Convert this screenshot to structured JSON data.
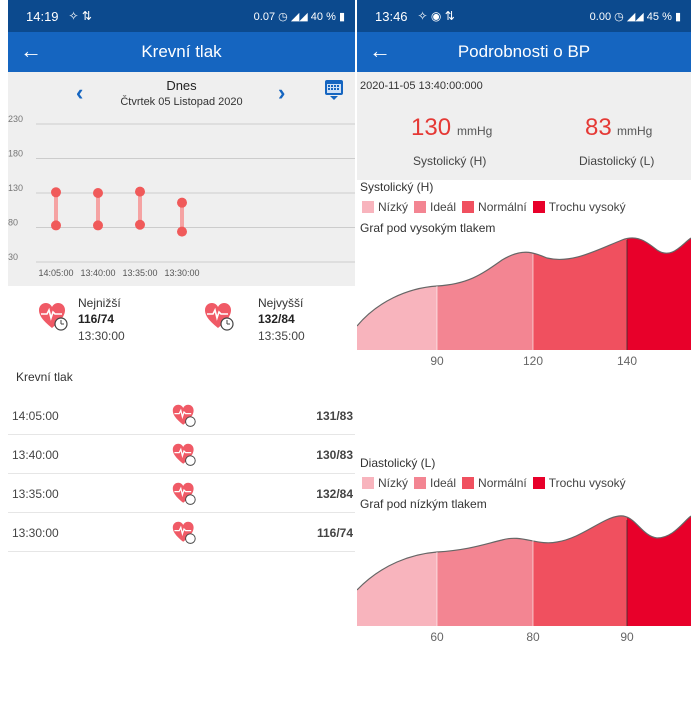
{
  "left": {
    "status": {
      "time": "14:19",
      "data_rate": "0.07",
      "battery": "40 %"
    },
    "appbar": {
      "title": "Krevní tlak"
    },
    "datebar": {
      "day_label": "Dnes",
      "date_text": "Čtvrtek 05 Listopad 2020"
    },
    "chart": {
      "type": "range",
      "y_ticks": [
        "230",
        "180",
        "130",
        "80",
        "30"
      ],
      "x_labels": [
        "14:05:00",
        "13:40:00",
        "13:35:00",
        "13:30:00"
      ],
      "ylim": [
        30,
        230
      ],
      "points": [
        {
          "x": "14:05:00",
          "sys": 131,
          "dia": 83
        },
        {
          "x": "13:40:00",
          "sys": 130,
          "dia": 83
        },
        {
          "x": "13:35:00",
          "sys": 132,
          "dia": 84
        },
        {
          "x": "13:30:00",
          "sys": 116,
          "dia": 74
        }
      ],
      "colors": {
        "dot": "#f05a5a",
        "bar": "#f5a3a3",
        "grid": "#cccccc"
      }
    },
    "summary": {
      "lowest": {
        "label": "Nejnižší",
        "value": "116/74",
        "time": "13:30:00"
      },
      "highest": {
        "label": "Nejvyšší",
        "value": "132/84",
        "time": "13:35:00"
      }
    },
    "list_title": "Krevní tlak",
    "rows": [
      {
        "time": "14:05:00",
        "value": "131/83"
      },
      {
        "time": "13:40:00",
        "value": "130/83"
      },
      {
        "time": "13:35:00",
        "value": "132/84"
      },
      {
        "time": "13:30:00",
        "value": "116/74"
      }
    ]
  },
  "right": {
    "status": {
      "time": "13:46",
      "data_rate": "0.00",
      "battery": "45 %"
    },
    "appbar": {
      "title": "Podrobnosti o BP"
    },
    "timestamp": "2020-11-05 13:40:00:000",
    "systolic": {
      "value": "130",
      "unit": "mmHg",
      "caption": "Systolický (H)"
    },
    "diastolic": {
      "value": "83",
      "unit": "mmHg",
      "caption": "Diastolický (L)"
    },
    "sys_section": {
      "title": "Systolický (H)",
      "graph_title": "Graf pod vysokým tlakem",
      "ticks": [
        "90",
        "120",
        "140"
      ]
    },
    "dia_section": {
      "title": "Diastolický (L)",
      "graph_title": "Graf pod nízkým tlakem",
      "ticks": [
        "60",
        "80",
        "90"
      ]
    },
    "legend": [
      {
        "label": "Nízký",
        "color": "#f8b4bd"
      },
      {
        "label": "Ideál",
        "color": "#f38592"
      },
      {
        "label": "Normální",
        "color": "#f0505f"
      },
      {
        "label": "Trochu vysoký",
        "color": "#e8002a"
      }
    ]
  }
}
